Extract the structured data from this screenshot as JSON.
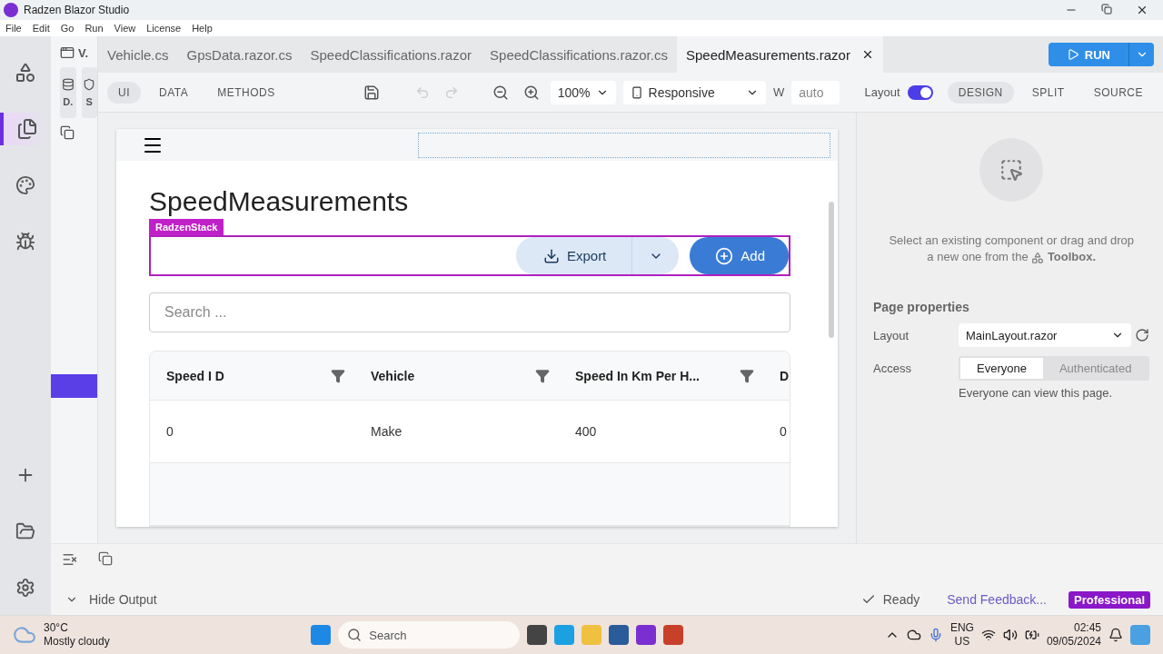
{
  "window": {
    "title": "Radzen Blazor Studio"
  },
  "menu": [
    "File",
    "Edit",
    "Go",
    "Run",
    "View",
    "License",
    "Help"
  ],
  "explorer": {
    "title": "V.",
    "buttons": [
      "D.",
      "S"
    ]
  },
  "tabs": [
    {
      "label": "Vehicle.cs",
      "selected": false
    },
    {
      "label": "GpsData.razor.cs",
      "selected": false
    },
    {
      "label": "SpeedClassifications.razor",
      "selected": false
    },
    {
      "label": "SpeedClassifications.razor.cs",
      "selected": false
    },
    {
      "label": "SpeedMeasurements.razor",
      "selected": true
    }
  ],
  "run_button": "RUN",
  "toolbar": {
    "modes": [
      {
        "label": "UI",
        "selected": true
      },
      {
        "label": "DATA",
        "selected": false
      },
      {
        "label": "METHODS",
        "selected": false
      }
    ],
    "zoom": "100%",
    "device": "Responsive",
    "width_label": "W",
    "width_value": "auto",
    "layout_label": "Layout",
    "layout_on": true,
    "views": [
      {
        "label": "DESIGN",
        "selected": true
      },
      {
        "label": "SPLIT",
        "selected": false
      },
      {
        "label": "SOURCE",
        "selected": false
      }
    ]
  },
  "canvas": {
    "heading": "SpeedMeasurements",
    "stack_label": "RadzenStack",
    "export_button": "Export",
    "add_button": "Add",
    "search": {
      "placeholder": "Search ..."
    },
    "table": {
      "columns": [
        "Speed I D",
        "Vehicle",
        "Speed In Km Per H...",
        "D"
      ],
      "rows": [
        [
          "0",
          "Make",
          "400",
          "0"
        ]
      ]
    }
  },
  "properties": {
    "hint": [
      "Select an existing component or drag and drop",
      "a new one from the"
    ],
    "hint_link": "Toolbox.",
    "title": "Page properties",
    "layout_label": "Layout",
    "layout_value": "MainLayout.razor",
    "access_label": "Access",
    "access_options": [
      {
        "label": "Everyone",
        "selected": true
      },
      {
        "label": "Authenticated",
        "selected": false
      }
    ],
    "access_note": "Everyone can view this page."
  },
  "status_bar": {
    "output_toggle": "Hide Output",
    "status": "Ready",
    "feedback": "Send Feedback...",
    "edition": "Professional"
  },
  "taskbar": {
    "temperature": "30°C",
    "weather": "Mostly cloudy",
    "search": "Search",
    "language": [
      "ENG",
      "US"
    ],
    "time": "02:45",
    "date": "09/05/2024"
  }
}
